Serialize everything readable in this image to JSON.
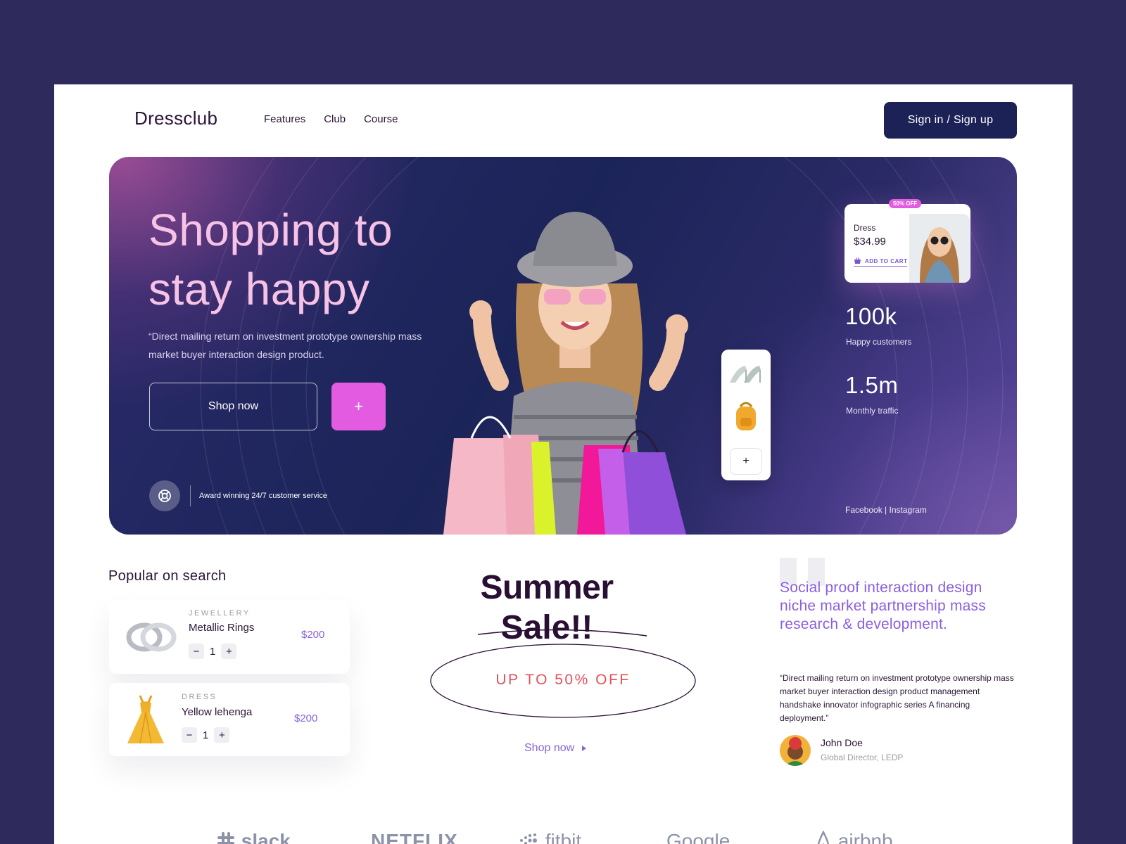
{
  "brand": {
    "logo": "Dressclub"
  },
  "nav": {
    "links": [
      "Features",
      "Club",
      "Course"
    ],
    "cta": "Sign in / Sign up"
  },
  "hero": {
    "title_line1": "Shopping to",
    "title_line2": "stay happy",
    "description": "“Direct mailing return on investment prototype ownership mass market buyer interaction design product.",
    "shop_button": "Shop now",
    "plus_button": "+",
    "support_text": "Award winning 24/7 customer service",
    "rail_plus": "+",
    "product": {
      "badge": "50% OFF",
      "name": "Dress",
      "price": "$34.99",
      "cart_label": "ADD TO CART"
    },
    "stats": [
      {
        "value": "100k",
        "label": "Happy customers"
      },
      {
        "value": "1.5m",
        "label": "Monthly traffic"
      }
    ],
    "social": "Facebook | Instagram"
  },
  "popular": {
    "title": "Popular on search",
    "items": [
      {
        "category": "JEWELLERY",
        "name": "Metallic Rings",
        "price": "$200",
        "qty": "1"
      },
      {
        "category": "DRESS",
        "name": "Yellow lehenga",
        "price": "$200",
        "qty": "1"
      }
    ],
    "minus": "−",
    "plus": "+"
  },
  "promo": {
    "line1": "Summer",
    "line2": "Sale!!",
    "offer": "UP TO 50% OFF",
    "shop_link": "Shop now"
  },
  "testimonial": {
    "headline": "Social proof interaction design niche market partnership mass research & development.",
    "body": "“Direct mailing return on investment prototype ownership mass market buyer interaction design product management handshake innovator infographic series A financing deployment.”",
    "author_name": "John Doe",
    "author_role": "Global Director, LEDP"
  },
  "logos": [
    "slack",
    "NETFLIX",
    "fitbit",
    "Google",
    "airbnb"
  ],
  "colors": {
    "background": "#2e2a5b",
    "accent_pink": "#e25be0",
    "accent_purple": "#8a63d9",
    "navy": "#1d2256",
    "offer_red": "#e2525a"
  }
}
